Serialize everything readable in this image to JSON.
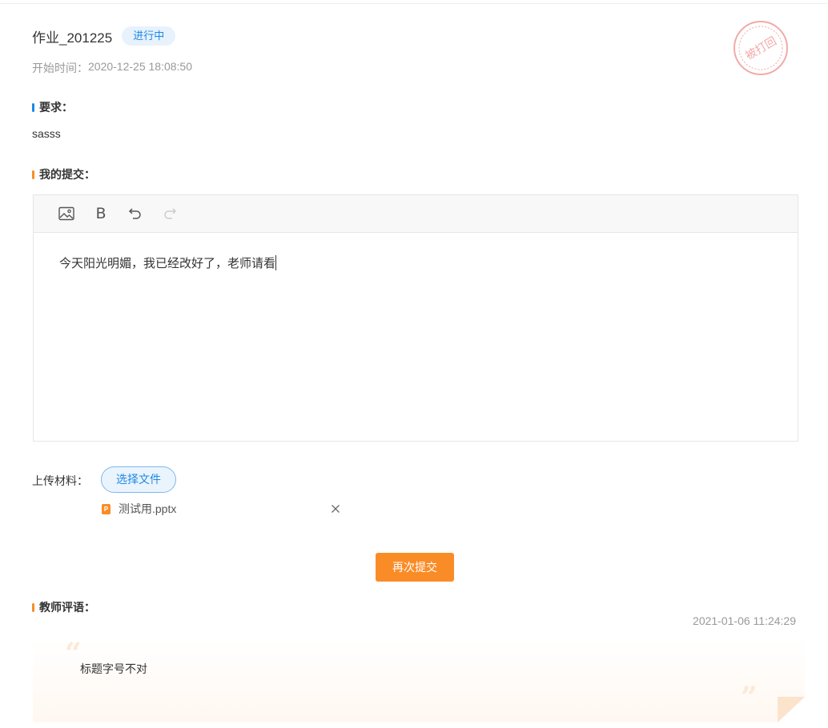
{
  "header": {
    "title": "作业_201225",
    "status": "进行中",
    "start_label": "开始时间：",
    "start_time": "2020-12-25 18:08:50",
    "stamp_text": "被打回"
  },
  "requirement": {
    "label": "要求：",
    "text": "sasss"
  },
  "submission": {
    "label": "我的提交：",
    "toolbar": {
      "image_icon": "image-icon",
      "bold_label": "B",
      "undo_icon": "undo-icon",
      "redo_icon": "redo-icon"
    },
    "content": "今天阳光明媚，我已经改好了，老师请看"
  },
  "upload": {
    "label": "上传材料：",
    "choose_button": "选择文件",
    "files": [
      {
        "icon": "P",
        "name": "测试用.pptx"
      }
    ]
  },
  "resubmit_button": "再次提交",
  "teacher_comment": {
    "label": "教师评语：",
    "time": "2021-01-06 11:24:29",
    "quote_open": "“",
    "quote_close": "”",
    "text": "标题字号不对"
  },
  "colors": {
    "accent_blue": "#1e88e5",
    "accent_orange": "#fa8c28",
    "stamp_red": "#f3a9a9"
  }
}
